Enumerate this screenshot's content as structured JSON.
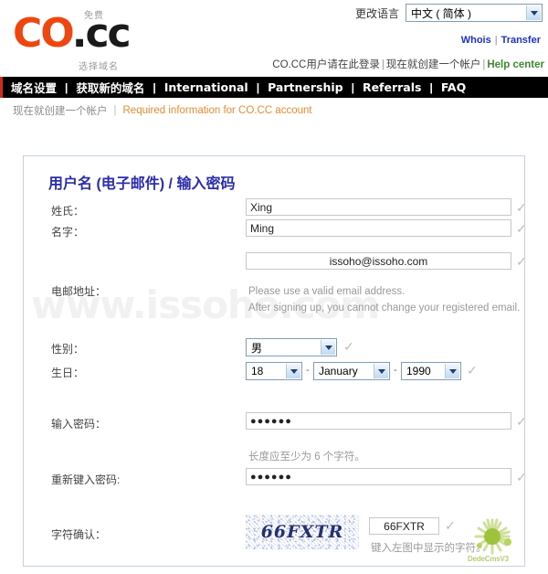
{
  "header": {
    "logo": {
      "free_text": "免费",
      "co": "CO",
      "cc": ".cc",
      "sub_text": "选择域名"
    },
    "language": {
      "label": "更改语言",
      "selected": "中文 ( 简体 )"
    },
    "top_links": {
      "whois": "Whois",
      "separator": "|",
      "transfer": "Transfer"
    },
    "account_links": {
      "login": "CO.CC用户请在此登录",
      "bar": "|",
      "create": "现在就创建一个帐户",
      "help": "Help center"
    }
  },
  "nav": {
    "separator": "|",
    "items": [
      {
        "label": "域名设置"
      },
      {
        "label": "获取新的域名"
      },
      {
        "label": "International"
      },
      {
        "label": "Partnership"
      },
      {
        "label": "Referrals"
      },
      {
        "label": "FAQ"
      }
    ]
  },
  "breadcrumb": {
    "current": "现在就创建一个帐户",
    "bar": "|",
    "detail": "Required information for CO.CC account"
  },
  "form": {
    "title": "用户名 (电子邮件) / 输入密码",
    "watermark": "www.issoho.com",
    "checkmark": "✓",
    "last_name": {
      "label": "姓氏：",
      "value": "Xing"
    },
    "first_name": {
      "label": "名字：",
      "value": "Ming"
    },
    "email": {
      "label": "电邮地址：",
      "value": "issoho@issoho.com",
      "hint_line1": "Please use a valid email address.",
      "hint_line2": "After signing up, you cannot change your registered email."
    },
    "gender": {
      "label": "性别：",
      "value": "男"
    },
    "birthday": {
      "label": "生日：",
      "day": "18",
      "month": "January",
      "year": "1990",
      "separator": "-"
    },
    "password": {
      "label": "输入密码：",
      "value": "●●●●●●",
      "hint": "长度应至少为 6 个字符。"
    },
    "password_confirm": {
      "label": "重新键入密码:",
      "value": "●●●●●●"
    },
    "captcha": {
      "label": "字符确认：",
      "image_text": "66FXTR",
      "value": "66FXTR",
      "hint": "键入左图中显示的字符。"
    }
  },
  "footer_logo": {
    "label": "DedeCmsV3"
  },
  "colors": {
    "logo_orange": "#ef4610",
    "nav_bg": "#000000",
    "nav_accent": "#d12b17",
    "title_blue": "#2b2bb0",
    "link_blue": "#1a33cc",
    "help_green": "#3d8b2f",
    "crumb_orange": "#ef8a2e"
  }
}
